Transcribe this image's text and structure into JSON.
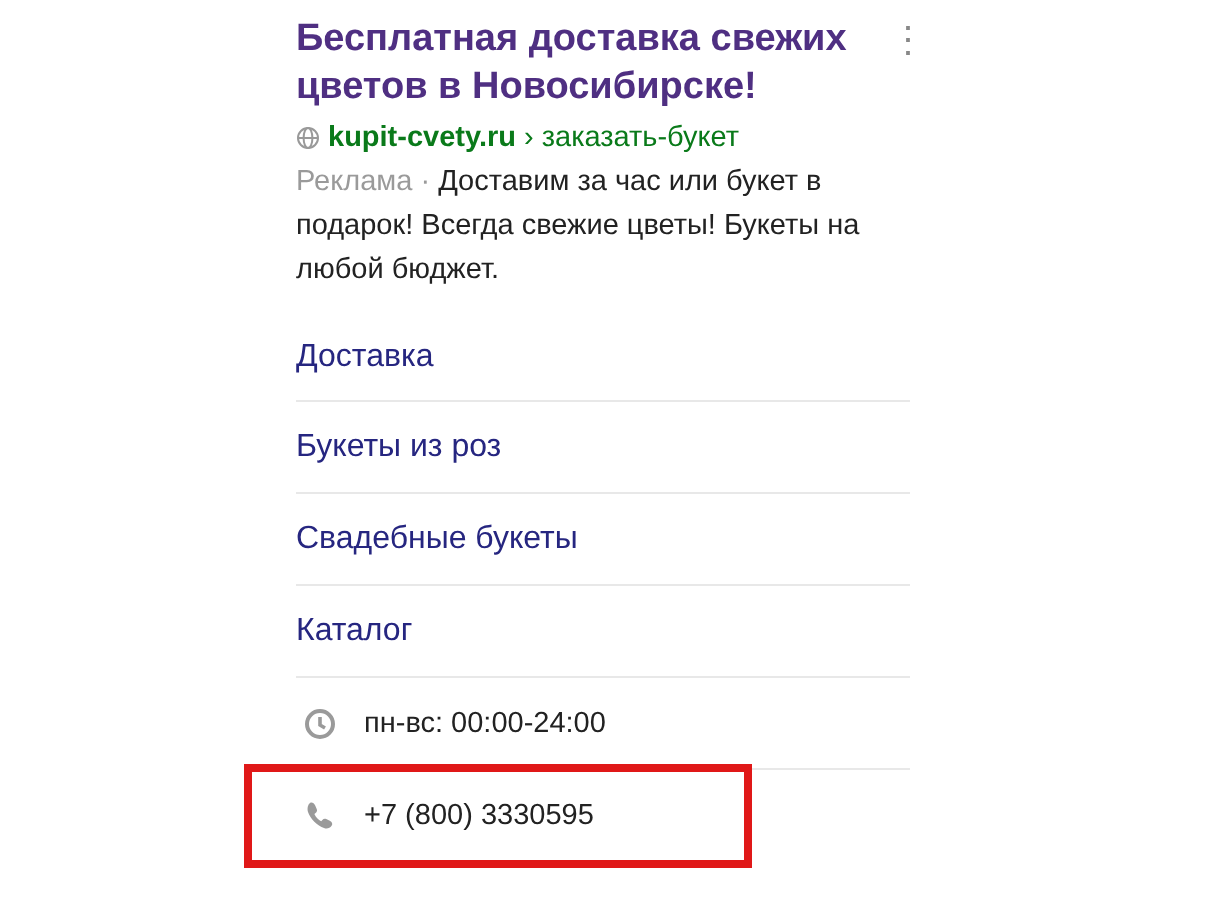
{
  "ad": {
    "title": "Бесплатная доставка свежих цветов в Новосибирске!",
    "menu_icon": "⋮",
    "domain": "kupit-cvety.ru",
    "separator": "›",
    "path": "заказать-букет",
    "label": "Реклама",
    "dot": "·",
    "text": "Доставим за час или букет в подарок! Всегда свежие цветы! Букеты на любой бюджет."
  },
  "sitelinks": [
    "Доставка",
    "Букеты из роз",
    "Свадебные букеты",
    "Каталог"
  ],
  "contacts": [
    {
      "kind": "hours",
      "text": "пн-вс: 00:00-24:00",
      "highlighted": false
    },
    {
      "kind": "phone",
      "text": "+7 (800) 3330595",
      "highlighted": true
    }
  ]
}
